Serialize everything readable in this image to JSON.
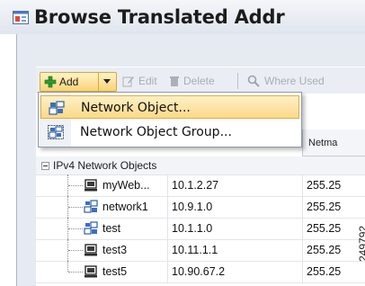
{
  "window": {
    "title": "Browse Translated Addr"
  },
  "toolbar": {
    "add_label": "Add",
    "edit_label": "Edit",
    "delete_label": "Delete",
    "where_used_label": "Where Used"
  },
  "add_menu": {
    "items": [
      {
        "label": "Network Object...",
        "highlighted": true
      },
      {
        "label": "Network Object Group...",
        "highlighted": false
      }
    ]
  },
  "table": {
    "columns": {
      "netmask": "Netma"
    },
    "group": {
      "label": "IPv4 Network Objects"
    },
    "rows": [
      {
        "name": "myWeb...",
        "ip": "10.1.2.27",
        "netmask": "255.25",
        "icon": "host-icon"
      },
      {
        "name": "network1",
        "ip": "10.9.1.0",
        "netmask": "255.25",
        "icon": "network-icon"
      },
      {
        "name": "test",
        "ip": "10.1.1.0",
        "netmask": "255.25",
        "icon": "network-icon"
      },
      {
        "name": "test3",
        "ip": "10.11.1.1",
        "netmask": "255.25",
        "icon": "host-icon"
      },
      {
        "name": "test5",
        "ip": "10.90.67.2",
        "netmask": "255.25",
        "icon": "host-icon"
      }
    ]
  },
  "figure_id": "249792",
  "colors": {
    "highlight": "#fbd98a",
    "add_icon": "#2e9b2e"
  }
}
